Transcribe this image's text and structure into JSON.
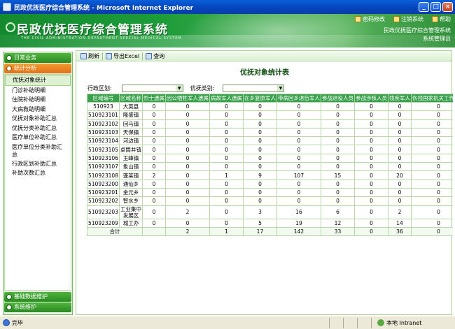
{
  "window": {
    "title": "民政优抚医疗综合管理系统 - Microsoft Internet Explorer",
    "buttons": [
      "_",
      "□",
      "×"
    ]
  },
  "banner": {
    "title": "民政优抚医疗综合管理系统",
    "subtitle": "THE CIVIL ADMINISTRATION DEPARTMENT SPECIAL MEDICAL SYSTEM",
    "links": [
      {
        "label": "密码修改",
        "icon": "key-icon"
      },
      {
        "label": "注销系统",
        "icon": "logout-icon"
      },
      {
        "label": "帮助",
        "icon": "help-icon"
      }
    ],
    "info_line1": "民政优抚医疗综合管理系统",
    "info_line2": "系统管理员"
  },
  "sidebar": {
    "sections": [
      {
        "label": "日常业务"
      },
      {
        "label": "统计分析",
        "active": true
      }
    ],
    "items": [
      {
        "label": "优抚对象统计",
        "active": true
      },
      {
        "label": "门诊补助明细"
      },
      {
        "label": "住院补助明细"
      },
      {
        "label": "大病救助明细"
      },
      {
        "label": "优抚对象补助汇总"
      },
      {
        "label": "优抚分类补助汇总"
      },
      {
        "label": "医疗单位补助汇总"
      },
      {
        "label": "医疗单位分类补助汇总",
        "two_line": true
      },
      {
        "label": "行政区划补助汇总"
      },
      {
        "label": "补助次数汇总"
      }
    ],
    "bottom_sections": [
      {
        "label": "基础数据维护"
      },
      {
        "label": "系统维护"
      }
    ]
  },
  "toolbar": {
    "refresh": "刷新",
    "export": "导出Excel",
    "query": "查询"
  },
  "page": {
    "title": "优抚对象统计表",
    "filter_region_label": "行政区划:",
    "filter_category_label": "优抚类别:"
  },
  "table": {
    "headers": [
      "区域编号",
      "区域名称",
      "烈士遗属",
      "因公牺牲军人遗属",
      "病故军人遗属",
      "在乡复原军人",
      "带病回乡退伍军人",
      "参战退役人员",
      "参战涉核人员",
      "残疾军人",
      "伤残国家机关工作人员"
    ],
    "rows": [
      [
        "510923",
        "大英县",
        "0",
        "0",
        "0",
        "0",
        "0",
        "0",
        "0",
        "0",
        "0"
      ],
      [
        "510923101",
        "隆盛镇",
        "0",
        "0",
        "0",
        "0",
        "0",
        "0",
        "0",
        "0",
        "0"
      ],
      [
        "510923102",
        "回马镇",
        "0",
        "0",
        "0",
        "0",
        "0",
        "0",
        "0",
        "0",
        "0"
      ],
      [
        "510923103",
        "天保镇",
        "0",
        "0",
        "0",
        "0",
        "0",
        "0",
        "0",
        "0",
        "0"
      ],
      [
        "510923104",
        "河边镇",
        "0",
        "0",
        "0",
        "0",
        "0",
        "0",
        "0",
        "0",
        "0"
      ],
      [
        "510923105",
        "卓筒井镇",
        "0",
        "0",
        "0",
        "0",
        "0",
        "0",
        "0",
        "0",
        "0"
      ],
      [
        "510923106",
        "玉峰镇",
        "0",
        "0",
        "0",
        "0",
        "0",
        "0",
        "0",
        "0",
        "0"
      ],
      [
        "510923107",
        "象山镇",
        "0",
        "0",
        "0",
        "0",
        "0",
        "0",
        "0",
        "0",
        "0"
      ],
      [
        "510923108",
        "蓬莱镇",
        "2",
        "0",
        "1",
        "9",
        "107",
        "15",
        "0",
        "20",
        "0"
      ],
      [
        "510923200",
        "通仙乡",
        "0",
        "0",
        "0",
        "0",
        "0",
        "0",
        "0",
        "0",
        "0"
      ],
      [
        "510923201",
        "金元乡",
        "0",
        "0",
        "0",
        "0",
        "0",
        "0",
        "0",
        "0",
        "0"
      ],
      [
        "510923202",
        "智水乡",
        "0",
        "0",
        "0",
        "0",
        "0",
        "0",
        "0",
        "0",
        "0"
      ],
      [
        "510923203",
        "工业集中发展区",
        "0",
        "2",
        "0",
        "3",
        "16",
        "6",
        "0",
        "2",
        "0"
      ],
      [
        "510923209",
        "城工办",
        "0",
        "0",
        "0",
        "5",
        "19",
        "12",
        "0",
        "14",
        "0"
      ]
    ],
    "total": [
      "合计",
      "",
      "2",
      "1",
      "17",
      "142",
      "33",
      "0",
      "36",
      "0"
    ]
  },
  "statusbar": {
    "left": "完毕",
    "zone": "本地 Intranet"
  }
}
